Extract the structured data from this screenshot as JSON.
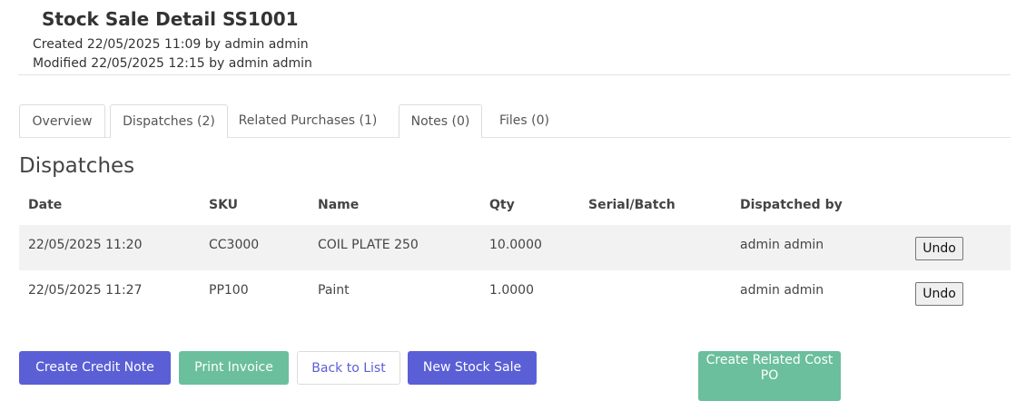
{
  "header": {
    "title": "Stock Sale Detail SS1001",
    "created": "Created 22/05/2025 11:09 by admin admin",
    "modified": "Modified 22/05/2025 12:15 by admin admin"
  },
  "tabs": [
    {
      "label": "Overview"
    },
    {
      "label": "Dispatches (2)"
    },
    {
      "label": "Related Purchases (1)"
    },
    {
      "label": "Notes (0)"
    },
    {
      "label": "Files (0)"
    }
  ],
  "section": {
    "title": "Dispatches"
  },
  "table": {
    "columns": [
      "Date",
      "SKU",
      "Name",
      "Qty",
      "Serial/Batch",
      "Dispatched by"
    ],
    "rows": [
      {
        "date": "22/05/2025 11:20",
        "sku": "CC3000",
        "name": "COIL PLATE 250",
        "qty": "10.0000",
        "serial": "",
        "dispatched_by": "admin admin",
        "action": "Undo"
      },
      {
        "date": "22/05/2025 11:27",
        "sku": "PP100",
        "name": "Paint",
        "qty": "1.0000",
        "serial": "",
        "dispatched_by": "admin admin",
        "action": "Undo"
      }
    ]
  },
  "actions": {
    "create_credit_note": "Create Credit Note",
    "print_invoice": "Print Invoice",
    "back_to_list": "Back to List",
    "new_stock_sale": "New Stock Sale",
    "create_related_cost_po": "Create Related Cost PO"
  },
  "colors": {
    "primary": "#5a5fd6",
    "success": "#6bbf9c",
    "row_stripe": "#f2f2f2"
  }
}
